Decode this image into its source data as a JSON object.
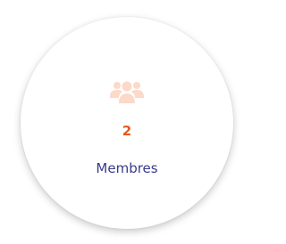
{
  "members_card": {
    "count": "2",
    "label": "Membres",
    "icon": "users-icon"
  },
  "colors": {
    "icon": "#fcd9c9",
    "count": "#e8591a",
    "label": "#3a3a8c"
  }
}
